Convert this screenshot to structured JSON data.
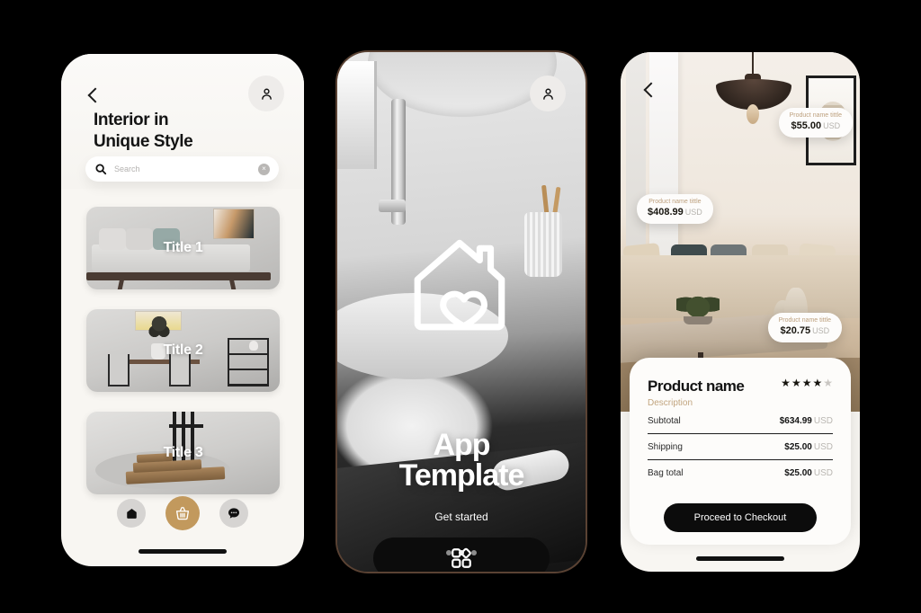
{
  "phone1": {
    "back_icon": "chevron-left-icon",
    "avatar_icon": "person-icon",
    "title": "Interior in\nUnique Style",
    "search": {
      "icon": "search-icon",
      "placeholder": "Search",
      "value": "",
      "clear_icon": "close-circle-icon",
      "clear_label": "×"
    },
    "cards": [
      {
        "label": "Title 1"
      },
      {
        "label": "Title 2"
      },
      {
        "label": "Title 3"
      }
    ],
    "nav": [
      {
        "name": "home",
        "icon": "home-icon"
      },
      {
        "name": "basket",
        "icon": "shopping-basket-icon",
        "accent_color": "#c2995d"
      },
      {
        "name": "chat",
        "icon": "chat-bubble-icon"
      }
    ]
  },
  "phone2": {
    "avatar_icon": "person-icon",
    "logo_icon": "house-heart-icon",
    "heading": "App\nTemplate",
    "subtitle": "Get started",
    "cta_icon": "grid-apps-icon",
    "dots": [
      {
        "active": false
      },
      {
        "active": true
      },
      {
        "active": false
      }
    ]
  },
  "phone3": {
    "back_icon": "chevron-left-icon",
    "tags": [
      {
        "name": "Product name tittle",
        "price": "$55.00",
        "currency": "USD"
      },
      {
        "name": "Product name tittle",
        "price": "$408.99",
        "currency": "USD"
      },
      {
        "name": "Product name tittle",
        "price": "$20.75",
        "currency": "USD"
      }
    ],
    "product": {
      "name": "Product name",
      "description": "Description",
      "rating": 4,
      "rating_max": 5,
      "star_filled": "★",
      "star_empty": "★"
    },
    "lines": [
      {
        "label": "Subtotal",
        "value": "$634.99",
        "currency": "USD"
      },
      {
        "label": "Shipping",
        "value": "$25.00",
        "currency": "USD"
      },
      {
        "label": "Bag total",
        "value": "$25.00",
        "currency": "USD"
      }
    ],
    "checkout_label": "Proceed to Checkout"
  },
  "colors": {
    "accent_gold": "#c2995d",
    "tag_text": "#bda07e",
    "background": "#000000",
    "screen": "#f8f6f2"
  }
}
